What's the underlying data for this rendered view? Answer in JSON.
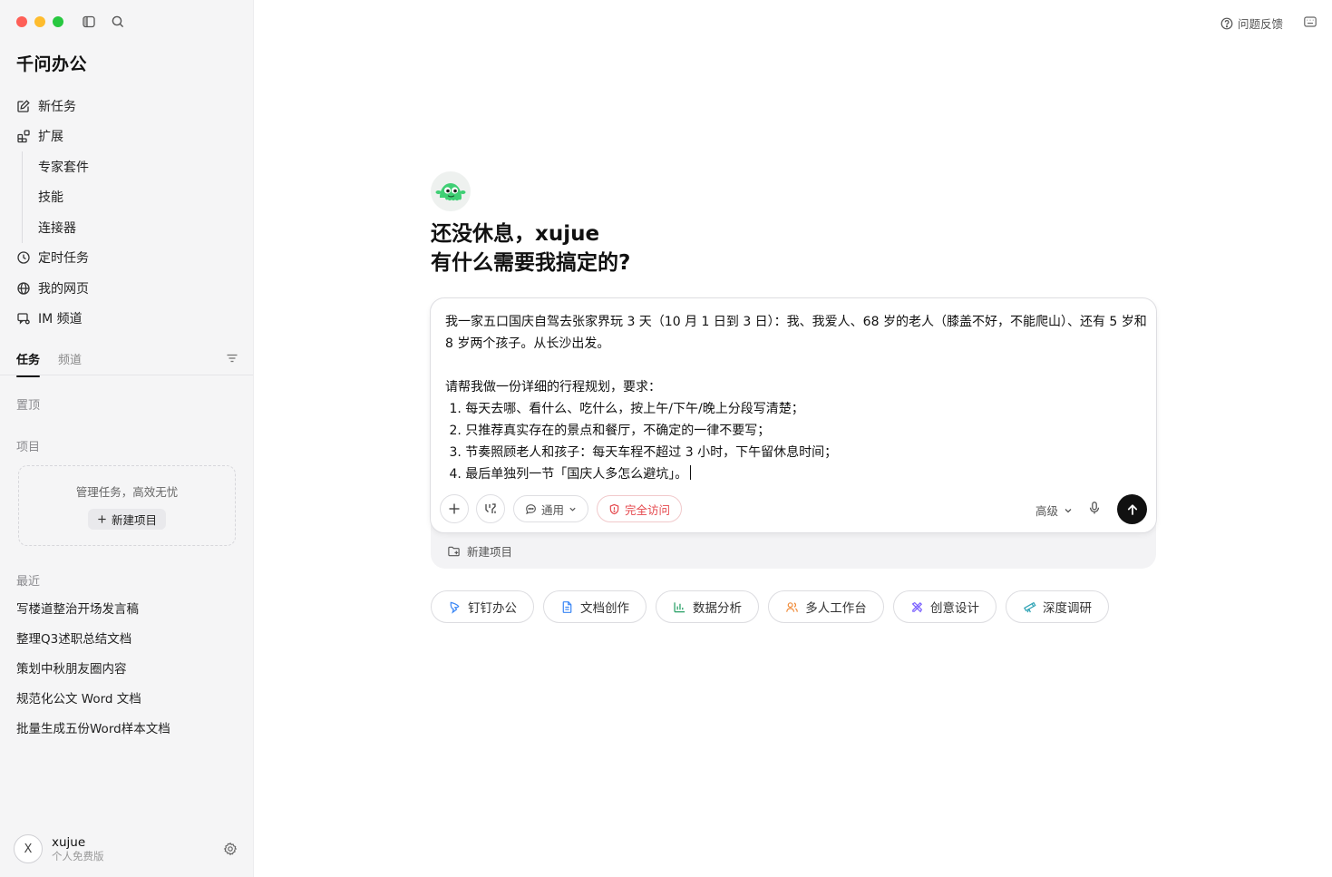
{
  "app": {
    "brand": "千问办公"
  },
  "nav": {
    "new_task": "新任务",
    "extend": "扩展",
    "expert_suite": "专家套件",
    "skills": "技能",
    "connectors": "连接器",
    "scheduled": "定时任务",
    "my_pages": "我的网页",
    "im_channel": "IM 频道"
  },
  "tabs": {
    "tasks": "任务",
    "channels": "频道"
  },
  "sections": {
    "pinned": "置顶",
    "projects": "项目",
    "project_hint": "管理任务，高效无忧",
    "new_project": "新建项目",
    "recent": "最近"
  },
  "recent": [
    "写楼道整治开场发言稿",
    "整理Q3述职总结文档",
    "策划中秋朋友圈内容",
    "规范化公文 Word 文档",
    "批量生成五份Word样本文档"
  ],
  "user": {
    "initial": "X",
    "name": "xujue",
    "plan": "个人免费版"
  },
  "topbar": {
    "feedback": "问题反馈"
  },
  "greeting": {
    "line1": "还没休息，xujue",
    "line2": "有什么需要我搞定的?"
  },
  "composer": {
    "text": "我一家五口国庆自驾去张家界玩 3 天（10 月 1 日到 3 日）：我、我爱人、68 岁的老人（膝盖不好，不能爬山）、还有 5 岁和 8 岁两个孩子。从长沙出发。\n\n请帮我做一份详细的行程规划，要求：\n 1. 每天去哪、看什么、吃什么，按上午/下午/晚上分段写清楚；\n 2. 只推荐真实存在的景点和餐厅，不确定的一律不要写；\n 3. 节奏照顾老人和孩子：每天车程不超过 3 小时，下午留休息时间；\n 4. 最后单独列一节「国庆人多怎么避坑」。",
    "mode": "通用",
    "access": "完全访问",
    "advanced": "高级",
    "footer_new_project": "新建项目"
  },
  "chips": [
    {
      "label": "钉钉办公",
      "icon": "dingtalk-icon"
    },
    {
      "label": "文档创作",
      "icon": "document-icon"
    },
    {
      "label": "数据分析",
      "icon": "chart-icon"
    },
    {
      "label": "多人工作台",
      "icon": "people-icon"
    },
    {
      "label": "创意设计",
      "icon": "design-icon"
    },
    {
      "label": "深度调研",
      "icon": "telescope-icon"
    }
  ],
  "colors": {
    "accent_danger": "#e5484d",
    "send_button": "#111111",
    "sidebar_bg": "#f5f5f6"
  }
}
